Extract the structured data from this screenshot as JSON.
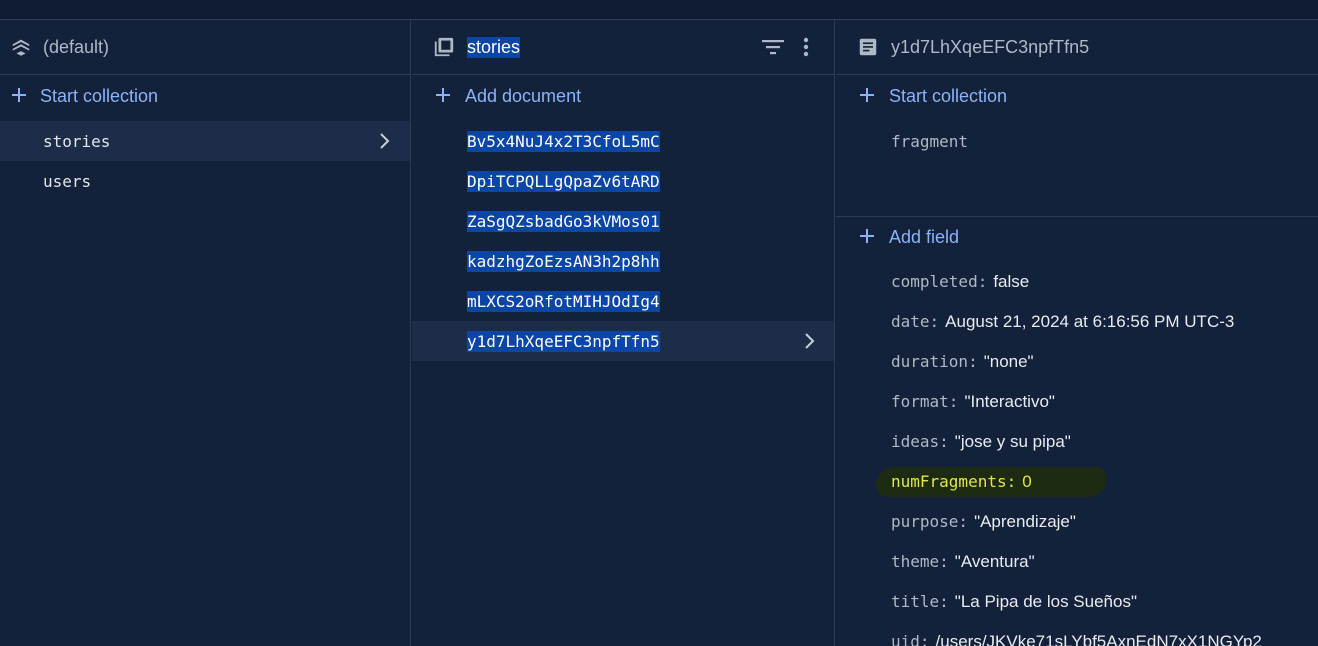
{
  "root_panel": {
    "title": "(default)",
    "header_icon": "firestore-stack-icon",
    "add_label": "Start collection",
    "collections": [
      {
        "label": "stories",
        "selected": true
      },
      {
        "label": "users",
        "selected": false
      }
    ]
  },
  "collection_panel": {
    "title": "stories",
    "header_icon": "collection-icon",
    "filter_icon": "filter-icon",
    "more_icon": "more-vert-icon",
    "add_label": "Add document",
    "documents": [
      "Bv5x4NuJ4x2T3CfoL5mC",
      "DpiTCPQLLgQpaZv6tARD",
      "ZaSgQZsbadGo3kVMos01",
      "kadzhgZoEzsAN3h2p8hh",
      "mLXCS2oRfotMIHJOdIg4",
      "y1d7LhXqeEFC3npfTfn5"
    ]
  },
  "document_panel": {
    "title": "y1d7LhXqeEFC3npfTfn5",
    "header_icon": "document-icon",
    "start_collection_label": "Start collection",
    "subcollections": [
      "fragment"
    ],
    "add_field_label": "Add field",
    "fields": [
      {
        "key": "completed:",
        "value": "false"
      },
      {
        "key": "date:",
        "value": "August 21, 2024 at 6:16:56 PM UTC-3"
      },
      {
        "key": "duration:",
        "value": "\"none\""
      },
      {
        "key": "format:",
        "value": "\"Interactivo\""
      },
      {
        "key": "ideas:",
        "value": "\"jose y su pipa\""
      },
      {
        "key": "numFragments:",
        "value": "0"
      },
      {
        "key": "purpose:",
        "value": "\"Aprendizaje\""
      },
      {
        "key": "theme:",
        "value": "\"Aventura\""
      },
      {
        "key": "title:",
        "value": "\"La Pipa de los Sueños\""
      },
      {
        "key": "uid:",
        "value": "/users/JKVke71sLYbf5AxnEdN7xX1NGYp2"
      }
    ]
  },
  "colors": {
    "background": "#13213a",
    "link": "#8ab4f8",
    "selection": "#0b45a6",
    "highlight_marker": "#1c2b12",
    "highlight_text": "#e3e64a"
  }
}
